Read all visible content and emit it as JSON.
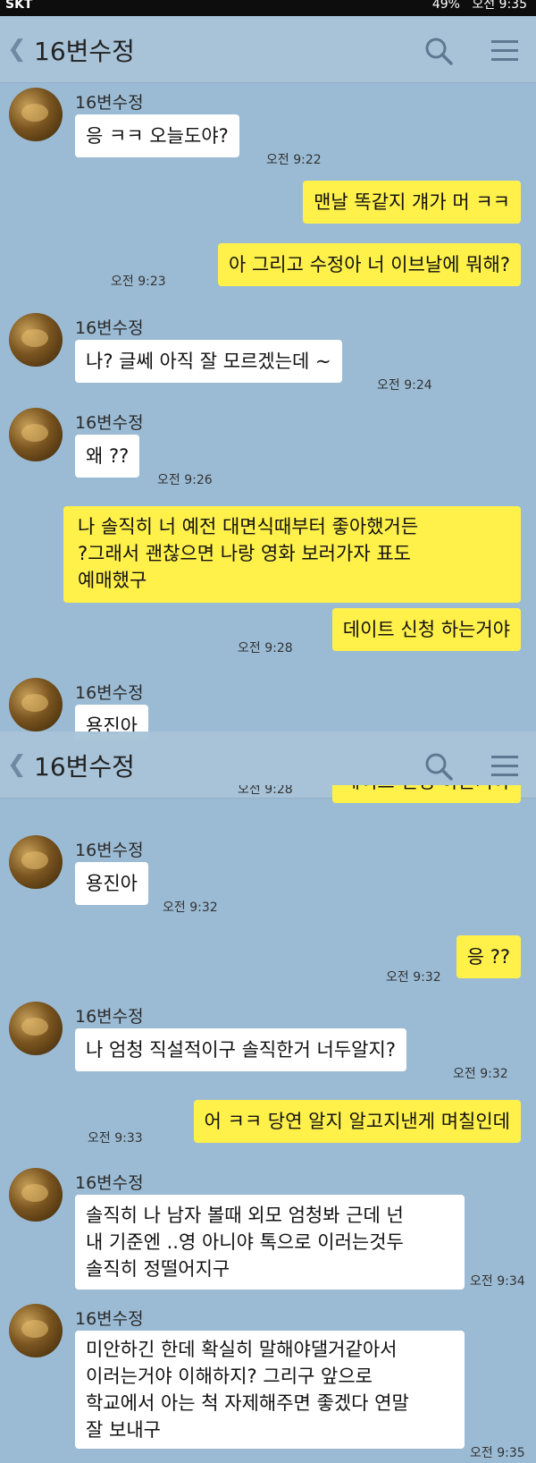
{
  "status_bar": {
    "carrier": "SKT",
    "battery": "49%",
    "clock": "오전 9:35"
  },
  "header": {
    "title": "16변수정"
  },
  "header_second": {
    "title": "16변수정"
  },
  "messages": [
    {
      "sender": "16변수정",
      "text": "응 ㅋㅋ 오늘도야?",
      "time": "오전 9:22"
    },
    {
      "text": "맨날 똑같지 걔가 머 ㅋㅋ",
      "time": ""
    },
    {
      "text": "아 그리고 수정아 너 이브날에 뭐해?",
      "time": "오전 9:23"
    },
    {
      "sender": "16변수정",
      "text": "나? 글쎄 아직 잘 모르겠는데 ~",
      "time": "오전 9:24"
    },
    {
      "sender": "16변수정",
      "text": "왜 ??",
      "time": "오전 9:26"
    },
    {
      "lines": [
        "나 솔직히 너 예전 대면식때부터 좋아했거든",
        "?그래서 괜찮으면 나랑 영화 보러가자 표도",
        "예매했구"
      ],
      "time": ""
    },
    {
      "text": "데이트 신청 하는거야",
      "time": "오전 9:28"
    },
    {
      "sender": "16변수정",
      "text": "용진아",
      "time": "오전 9:32"
    },
    {
      "text": "데이트 신청 하는거야",
      "time": "오전 9:28"
    },
    {
      "sender": "16변수정",
      "text": "용진아",
      "time": "오전 9:32"
    },
    {
      "text": "응 ??",
      "time": "오전 9:32"
    },
    {
      "sender": "16변수정",
      "text": "나 엄청 직설적이구 솔직한거 너두알지?",
      "time": "오전 9:32"
    },
    {
      "text": "어 ㅋㅋ 당연 알지 알고지낸게 며칠인데",
      "time": "오전 9:33"
    },
    {
      "sender": "16변수정",
      "lines": [
        "솔직히 나 남자 볼때 외모 엄청봐 근데 넌",
        "내 기준엔 ..영 아니야 톡으로 이러는것두",
        "솔직히 정떨어지구"
      ],
      "time": "오전 9:34"
    },
    {
      "sender": "16변수정",
      "lines": [
        "미안하긴 한데 확실히 말해야댈거같아서",
        "이러는거야 이해하지? 그리구 앞으로",
        "학교에서 아는 척 자제해주면 좋겠다 연말",
        "잘 보내구"
      ],
      "time": "오전 9:35"
    }
  ],
  "colors": {
    "background": "#9bbbd4",
    "incoming": "#ffffff",
    "outgoing": "#fff04a"
  },
  "icons": {
    "back": "chevron-left-icon",
    "search": "search-icon",
    "menu": "hamburger-menu-icon"
  }
}
